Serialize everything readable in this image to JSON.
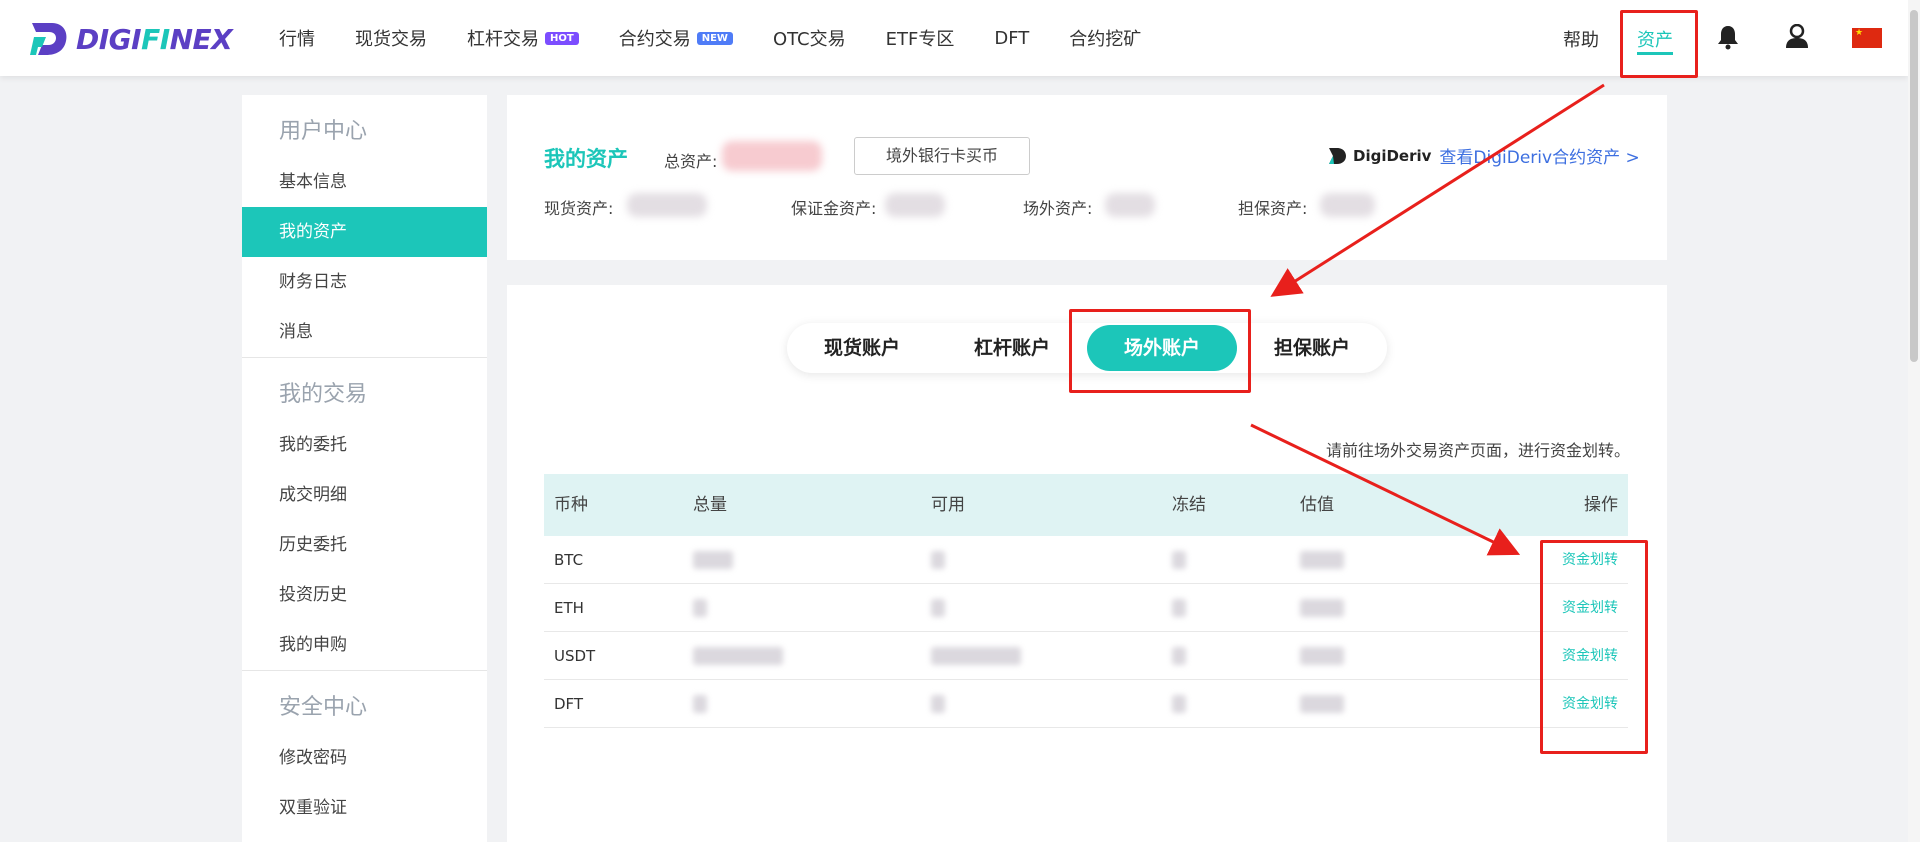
{
  "header": {
    "logo_text_a": "DIGI",
    "logo_text_b": "FI",
    "logo_text_c": "NEX",
    "nav": [
      {
        "label": "行情"
      },
      {
        "label": "现货交易"
      },
      {
        "label": "杠杆交易",
        "badge": "HOT"
      },
      {
        "label": "合约交易",
        "badge": "NEW"
      },
      {
        "label": "OTC交易"
      },
      {
        "label": "ETF专区"
      },
      {
        "label": "DFT"
      },
      {
        "label": "合约挖矿"
      }
    ],
    "help": "帮助",
    "assets": "资产",
    "icons": {
      "bell": "bell-icon",
      "user": "user-icon",
      "flag": "china-flag-icon"
    }
  },
  "sidebar": {
    "sections": [
      {
        "title": "用户中心",
        "items": [
          "基本信息",
          "我的资产",
          "财务日志",
          "消息"
        ]
      },
      {
        "title": "我的交易",
        "items": [
          "我的委托",
          "成交明细",
          "历史委托",
          "投资历史",
          "我的申购"
        ]
      },
      {
        "title": "安全中心",
        "items": [
          "修改密码",
          "双重验证"
        ]
      }
    ],
    "active_item": "我的资产"
  },
  "summary": {
    "title": "我的资产",
    "total_label": "总资产:",
    "bank_button": "境外银行卡买币",
    "digideriv_name": "DigiDeriv",
    "digideriv_link": "查看DigiDeriv合约资产 >",
    "spot_label": "现货资产:",
    "margin_label": "保证金资产:",
    "otc_label": "场外资产:",
    "guarantee_label": "担保资产:"
  },
  "accounts": {
    "tabs": [
      "现货账户",
      "杠杆账户",
      "场外账户",
      "担保账户"
    ],
    "active_tab": "场外账户",
    "note": "请前往场外交易资产页面，进行资金划转。",
    "columns": [
      "币种",
      "总量",
      "可用",
      "冻结",
      "估值",
      "操作"
    ],
    "rows": [
      {
        "coin": "BTC",
        "action": "资金划转"
      },
      {
        "coin": "ETH",
        "action": "资金划转"
      },
      {
        "coin": "USDT",
        "action": "资金划转"
      },
      {
        "coin": "DFT",
        "action": "资金划转"
      }
    ]
  },
  "colors": {
    "accent": "#1cc6b9",
    "brand": "#5b3fc4",
    "annotation": "#e8201c",
    "link": "#3d6fe0"
  }
}
